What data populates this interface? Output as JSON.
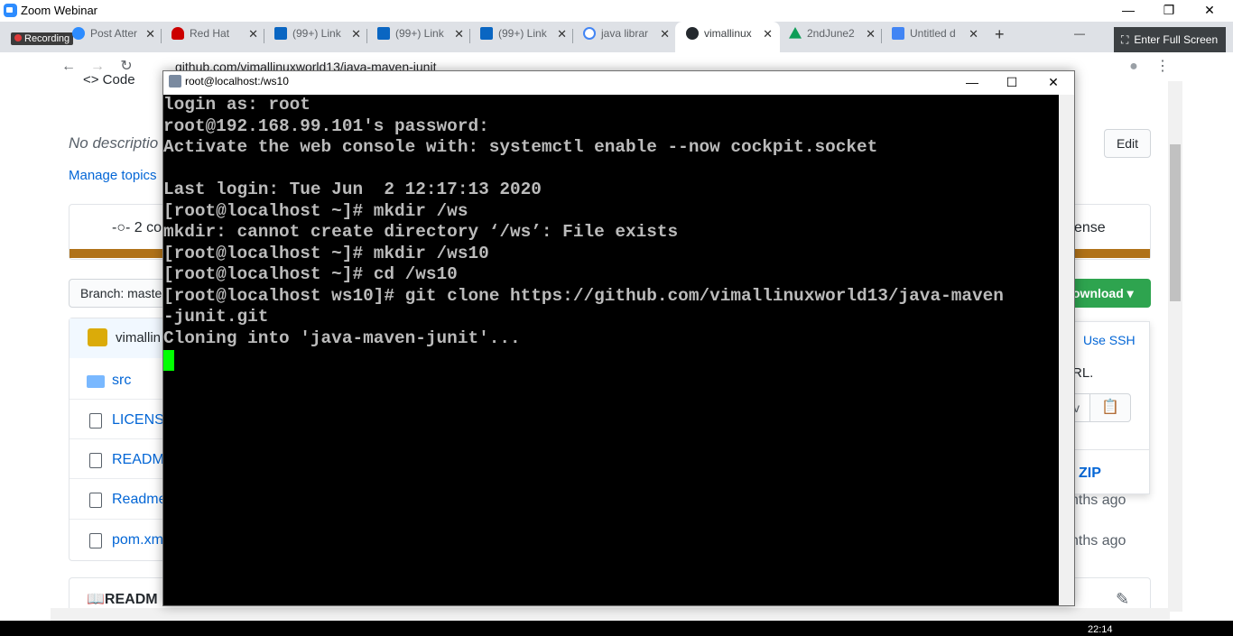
{
  "zoom": {
    "title": "Zoom Webinar",
    "recording_label": "Recording",
    "fullscreen_label": "Enter Full Screen",
    "minimize": "—",
    "restore": "❐",
    "close": "✕"
  },
  "browser": {
    "tabs": [
      {
        "label": "Post Atter",
        "icon": "zoom-icon",
        "color": "#2d8cff"
      },
      {
        "label": "Red Hat",
        "icon": "redhat-icon",
        "color": "#cc0000"
      },
      {
        "label": "(99+) Link",
        "icon": "linkedin-icon",
        "color": "#0a66c2"
      },
      {
        "label": "(99+) Link",
        "icon": "linkedin-icon",
        "color": "#0a66c2"
      },
      {
        "label": "(99+) Link",
        "icon": "linkedin-icon",
        "color": "#0a66c2"
      },
      {
        "label": "java librar",
        "icon": "google-icon",
        "color": "#4285f4"
      },
      {
        "label": "vimallinux",
        "icon": "github-icon",
        "color": "#24292e"
      },
      {
        "label": "2ndJune2",
        "icon": "drive-icon",
        "color": "#0f9d58"
      },
      {
        "label": "Untitled d",
        "icon": "docs-icon",
        "color": "#4285f4"
      }
    ],
    "new_tab": "+",
    "url": "github.com/vimallinuxworld13/java-maven-junit"
  },
  "github": {
    "code_tab": "<> Code",
    "description": "No descriptio",
    "manage_topics": "Manage topics",
    "edit": "Edit",
    "commits": "2 co",
    "license": "ense",
    "branch": "Branch: maste",
    "download": "ownload ▾",
    "owner": "vimallin",
    "files": [
      "src",
      "LICENS",
      "READM",
      "Readme",
      "pom.xm"
    ],
    "times": [
      "nths ago",
      "nths ago"
    ],
    "clone": {
      "use_ssh": "Use SSH",
      "url_fragment": "RL.",
      "input_fragment": "v",
      "zip": "ZIP"
    },
    "readme_header": "READM"
  },
  "putty": {
    "title": "root@localhost:/ws10",
    "lines": [
      "login as: root",
      "root@192.168.99.101's password:",
      "Activate the web console with: systemctl enable --now cockpit.socket",
      "",
      "Last login: Tue Jun  2 12:17:13 2020",
      "[root@localhost ~]# mkdir /ws",
      "mkdir: cannot create directory ‘/ws’: File exists",
      "[root@localhost ~]# mkdir /ws10",
      "[root@localhost ~]# cd /ws10",
      "[root@localhost ws10]# git clone https://github.com/vimallinuxworld13/java-maven",
      "-junit.git",
      "Cloning into 'java-maven-junit'..."
    ]
  },
  "taskbar": {
    "time": "22:14"
  }
}
